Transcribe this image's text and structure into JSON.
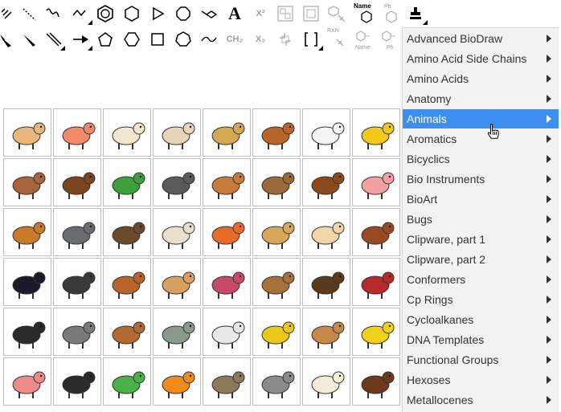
{
  "toolbar": {
    "text_tool_label": "A",
    "superscript_label": "X²",
    "subscript_label": "X₂",
    "ch2_label": "CH₂",
    "name_struct_label": "Name",
    "name_label": "Name",
    "ph_label": "Ph",
    "rxn_label": "RXN"
  },
  "menu": {
    "items": [
      {
        "label": "Advanced BioDraw"
      },
      {
        "label": "Amino Acid Side Chains"
      },
      {
        "label": "Amino Acids"
      },
      {
        "label": "Anatomy"
      },
      {
        "label": "Animals"
      },
      {
        "label": "Aromatics"
      },
      {
        "label": "Bicyclics"
      },
      {
        "label": "Bio Instruments"
      },
      {
        "label": "BioArt"
      },
      {
        "label": "Bugs"
      },
      {
        "label": "Clipware, part 1"
      },
      {
        "label": "Clipware, part 2"
      },
      {
        "label": "Conformers"
      },
      {
        "label": "Cp Rings"
      },
      {
        "label": "Cycloalkanes"
      },
      {
        "label": "DNA Templates"
      },
      {
        "label": "Functional Groups"
      },
      {
        "label": "Hexoses"
      },
      {
        "label": "Metallocenes"
      }
    ],
    "active_item": "Animals"
  },
  "animals": [
    {
      "icon": "guinea-pig-icon",
      "color": "#e8b878"
    },
    {
      "icon": "shrimp-icon",
      "color": "#f08a6a"
    },
    {
      "icon": "rat-icon",
      "color": "#f2e6cf"
    },
    {
      "icon": "rabbit-icon",
      "color": "#e8d2b8"
    },
    {
      "icon": "monkey-icon",
      "color": "#d4a852"
    },
    {
      "icon": "weasel-icon",
      "color": "#b8652a"
    },
    {
      "icon": "white-mouse-icon",
      "color": "#f3f3f3"
    },
    {
      "icon": "goldfinch-icon",
      "color": "#f2c81a"
    },
    {
      "icon": "macaque-icon",
      "color": "#a8643c"
    },
    {
      "icon": "horse-icon",
      "color": "#7a4420"
    },
    {
      "icon": "frog-icon",
      "color": "#3ea03a"
    },
    {
      "icon": "bat-icon",
      "color": "#5a5a5a"
    },
    {
      "icon": "beagle-icon",
      "color": "#c87a3a"
    },
    {
      "icon": "bear-icon",
      "color": "#9a6a38"
    },
    {
      "icon": "brown-horse-icon",
      "color": "#8a4a1a"
    },
    {
      "icon": "pig-icon",
      "color": "#f2a0a0"
    },
    {
      "icon": "squirrel-icon",
      "color": "#c87a28"
    },
    {
      "icon": "pigeon-icon",
      "color": "#6a6a72"
    },
    {
      "icon": "bison-icon",
      "color": "#6a4a2a"
    },
    {
      "icon": "sheep-icon",
      "color": "#e8e0cc"
    },
    {
      "icon": "turkey-icon",
      "color": "#e86a28"
    },
    {
      "icon": "camel-icon",
      "color": "#d8a858"
    },
    {
      "icon": "cat-icon",
      "color": "#f0d6a8"
    },
    {
      "icon": "hen-icon",
      "color": "#9a4a22"
    },
    {
      "icon": "magpie-icon",
      "color": "#1a1a2a"
    },
    {
      "icon": "calf-icon",
      "color": "#3a3a3a"
    },
    {
      "icon": "cow-icon",
      "color": "#b8642a"
    },
    {
      "icon": "great-dane-icon",
      "color": "#d8a060"
    },
    {
      "icon": "sea-anemone-icon",
      "color": "#c84a6a"
    },
    {
      "icon": "duck-icon",
      "color": "#a8703a"
    },
    {
      "icon": "eagle-icon",
      "color": "#5a3a1a"
    },
    {
      "icon": "rooster-icon",
      "color": "#b82a2a"
    },
    {
      "icon": "chimpanzee-icon",
      "color": "#2a2a2a"
    },
    {
      "icon": "badger-icon",
      "color": "#7a7a7a"
    },
    {
      "icon": "st-bernard-icon",
      "color": "#b06a32"
    },
    {
      "icon": "elephant-icon",
      "color": "#8a9a8a"
    },
    {
      "icon": "dalmatian-icon",
      "color": "#e8e8e8"
    },
    {
      "icon": "ferret-icon",
      "color": "#e8c81a"
    },
    {
      "icon": "kangaroo-icon",
      "color": "#c8884a"
    },
    {
      "icon": "lion-icon",
      "color": "#f0d01a"
    },
    {
      "icon": "worm-icon",
      "color": "#f08a8a"
    },
    {
      "icon": "zebra-icon",
      "color": "#2a2a2a"
    },
    {
      "icon": "sea-turtle-icon",
      "color": "#4ab04a"
    },
    {
      "icon": "tiger-icon",
      "color": "#f08a1a"
    },
    {
      "icon": "snail-icon",
      "color": "#8a7a5a"
    },
    {
      "icon": "rhinoceros-icon",
      "color": "#8a8a8a"
    },
    {
      "icon": "polar-bear-icon",
      "color": "#f2ecd8"
    },
    {
      "icon": "moose-icon",
      "color": "#6a3a1a"
    }
  ]
}
